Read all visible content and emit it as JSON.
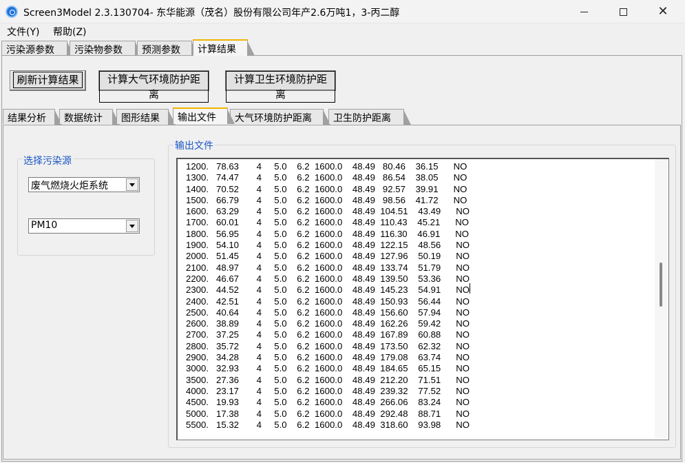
{
  "window": {
    "title": "Screen3Model 2.3.130704- 东华能源（茂名）股份有限公司年产2.6万吨1，3-丙二醇",
    "minimize": "minimize",
    "maximize": "maximize",
    "close": "✕"
  },
  "menu": {
    "file": "文件(Y)",
    "help": "帮助(Z)"
  },
  "outer_tabs": [
    "污染源参数",
    "污染物参数",
    "预测参数",
    "计算结果"
  ],
  "buttons": {
    "refresh": "刷新计算结果",
    "calc_air": "计算大气环境防护距离",
    "calc_health": "计算卫生环境防护距离"
  },
  "inner_tabs": [
    "结果分析",
    "数据统计",
    "图形结果",
    "输出文件",
    "大气环境防护距离",
    "卫生防护距离"
  ],
  "source_group": {
    "legend": "选择污染源",
    "source_value": "废气燃烧火炬系统",
    "pollutant_value": "PM10"
  },
  "output_group": {
    "legend": "输出文件",
    "lines": [
      "1200.   78.63       4     5.0    6.2  1600.0    48.49   80.46    36.15      NO",
      "1300.   74.47       4     5.0    6.2  1600.0    48.49   86.54    38.05      NO",
      "1400.   70.52       4     5.0    6.2  1600.0    48.49   92.57    39.91      NO",
      "1500.   66.79       4     5.0    6.2  1600.0    48.49   98.56    41.72      NO",
      "1600.   63.29       4     5.0    6.2  1600.0    48.49  104.51    43.49      NO",
      "1700.   60.01       4     5.0    6.2  1600.0    48.49  110.43    45.21      NO",
      "1800.   56.95       4     5.0    6.2  1600.0    48.49  116.30    46.91      NO",
      "1900.   54.10       4     5.0    6.2  1600.0    48.49  122.15    48.56      NO",
      "2000.   51.45       4     5.0    6.2  1600.0    48.49  127.96    50.19      NO",
      "2100.   48.97       4     5.0    6.2  1600.0    48.49  133.74    51.79      NO",
      "2200.   46.67       4     5.0    6.2  1600.0    48.49  139.50    53.36      NO",
      "2300.   44.52       4     5.0    6.2  1600.0    48.49  145.23    54.91      NO",
      "2400.   42.51       4     5.0    6.2  1600.0    48.49  150.93    56.44      NO",
      "2500.   40.64       4     5.0    6.2  1600.0    48.49  156.60    57.94      NO",
      "2600.   38.89       4     5.0    6.2  1600.0    48.49  162.26    59.42      NO",
      "2700.   37.25       4     5.0    6.2  1600.0    48.49  167.89    60.88      NO",
      "2800.   35.72       4     5.0    6.2  1600.0    48.49  173.50    62.32      NO",
      "2900.   34.28       4     5.0    6.2  1600.0    48.49  179.08    63.74      NO",
      "3000.   32.93       4     5.0    6.2  1600.0    48.49  184.65    65.15      NO",
      "3500.   27.36       4     5.0    6.2  1600.0    48.49  212.20    71.51      NO",
      "4000.   23.17       4     5.0    6.2  1600.0    48.49  239.32    77.52      NO",
      "4500.   19.93       4     5.0    6.2  1600.0    48.49  266.06    83.24      NO",
      "5000.   17.38       4     5.0    6.2  1600.0    48.49  292.48    88.71      NO",
      "5500.   15.32       4     5.0    6.2  1600.0    48.49  318.60    93.98      NO"
    ]
  }
}
